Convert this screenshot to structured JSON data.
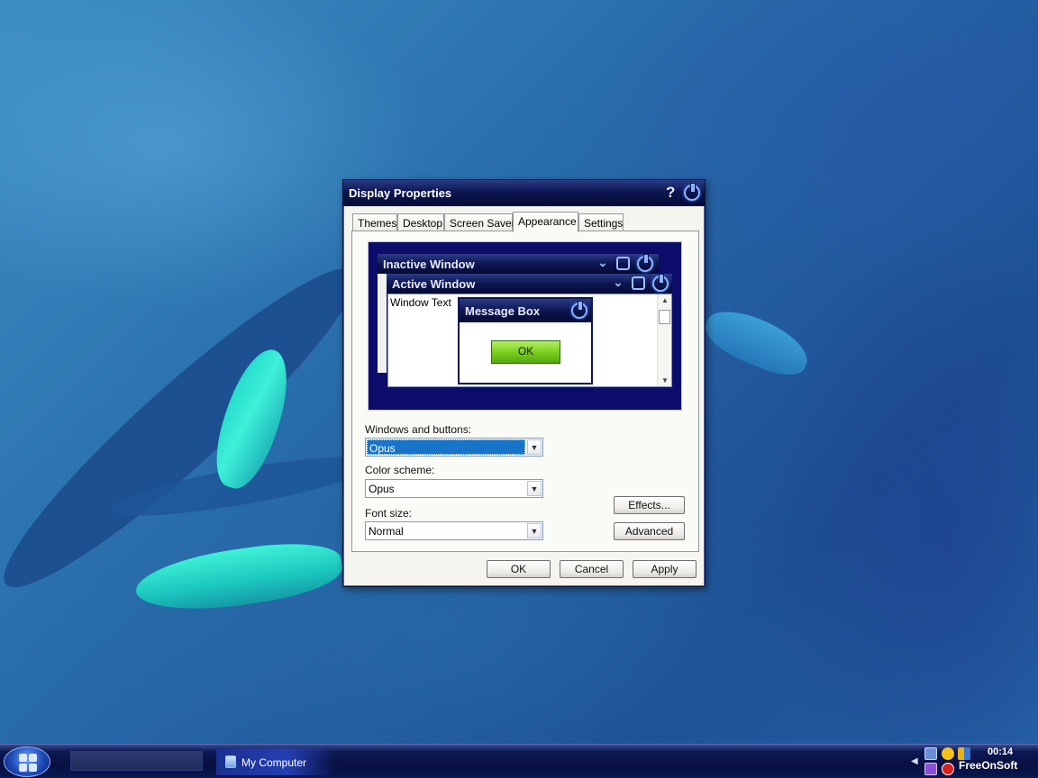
{
  "dialog": {
    "title": "Display Properties",
    "help_label": "?",
    "close_icon": "power-icon",
    "tabs": [
      {
        "label": "Themes"
      },
      {
        "label": "Desktop"
      },
      {
        "label": "Screen Saver"
      },
      {
        "label": "Appearance",
        "active": true
      },
      {
        "label": "Settings"
      }
    ],
    "preview": {
      "inactive_title": "Inactive Window",
      "active_title": "Active Window",
      "window_text": "Window Text",
      "message_box_title": "Message Box",
      "message_box_ok": "OK"
    },
    "windows_buttons_label": "Windows and buttons:",
    "windows_buttons_value": "Opus",
    "color_scheme_label": "Color scheme:",
    "color_scheme_value": "Opus",
    "font_size_label": "Font size:",
    "font_size_value": "Normal",
    "effects_label": "Effects...",
    "advanced_label": "Advanced",
    "ok_label": "OK",
    "cancel_label": "Cancel",
    "apply_label": "Apply"
  },
  "taskbar": {
    "start_icon": "windows-logo-icon",
    "task_item": "My Computer",
    "clock": "00:14",
    "brand": "FreeOnSoft"
  },
  "colors": {
    "accent_green": "#7bd021",
    "title_navy": "#0c1650",
    "selection_blue": "#1874c8"
  }
}
